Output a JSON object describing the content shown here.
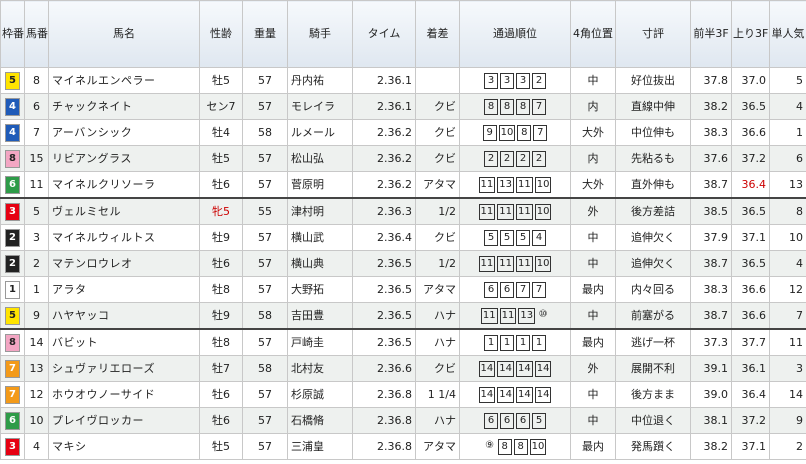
{
  "headers": {
    "waku": "枠番",
    "umaban": "馬番",
    "name": "馬名",
    "sexage": "性齢",
    "weight": "重量",
    "jockey": "騎手",
    "time": "タイム",
    "margin": "着差",
    "passing": "通過順位",
    "corner4": "4角位置",
    "comment": "寸評",
    "first3f": "前半3F",
    "last3f": "上り3F",
    "pop": "単人気"
  },
  "colors": {
    "waku1": "#ffffff",
    "waku2": "#222222",
    "waku3": "#e60012",
    "waku4": "#1f5bb8",
    "waku5": "#ffe400",
    "waku6": "#2e9b48",
    "waku7": "#f39a19",
    "waku8": "#f3a6c3",
    "highlight": "#cc0000"
  },
  "rows": [
    {
      "waku": "5",
      "umaban": "8",
      "name": "マイネルエンペラー",
      "sexage": "牡5",
      "weight": "57",
      "jockey": "丹内祐",
      "time": "2.36.1",
      "margin": "",
      "passing": [
        "3",
        "3",
        "3",
        "2"
      ],
      "corner4": "中",
      "comment": "好位抜出",
      "first3f": "37.8",
      "last3f": "37.0",
      "pop": "5"
    },
    {
      "waku": "4",
      "umaban": "6",
      "name": "チャックネイト",
      "sexage": "セン7",
      "weight": "57",
      "jockey": "モレイラ",
      "time": "2.36.1",
      "margin": "クビ",
      "passing": [
        "8",
        "8",
        "8",
        "7"
      ],
      "corner4": "内",
      "comment": "直線中伸",
      "first3f": "38.2",
      "last3f": "36.5",
      "pop": "4"
    },
    {
      "waku": "4",
      "umaban": "7",
      "name": "アーバンシック",
      "sexage": "牡4",
      "weight": "58",
      "jockey": "ルメール",
      "time": "2.36.2",
      "margin": "クビ",
      "passing": [
        "9",
        "10",
        "8",
        "7"
      ],
      "corner4": "大外",
      "comment": "中位伸も",
      "first3f": "38.3",
      "last3f": "36.6",
      "pop": "1"
    },
    {
      "waku": "8",
      "umaban": "15",
      "name": "リビアングラス",
      "sexage": "牡5",
      "weight": "57",
      "jockey": "松山弘",
      "time": "2.36.2",
      "margin": "クビ",
      "passing": [
        "2",
        "2",
        "2",
        "2"
      ],
      "corner4": "内",
      "comment": "先粘るも",
      "first3f": "37.6",
      "last3f": "37.2",
      "pop": "6"
    },
    {
      "waku": "6",
      "umaban": "11",
      "name": "マイネルクリソーラ",
      "sexage": "牡6",
      "weight": "57",
      "jockey": "菅原明",
      "time": "2.36.2",
      "margin": "アタマ",
      "passing": [
        "11",
        "13",
        "11",
        "10"
      ],
      "corner4": "大外",
      "comment": "直外伸も",
      "first3f": "38.7",
      "last3f": "36.4",
      "pop": "13"
    },
    {
      "waku": "3",
      "umaban": "5",
      "name": "ヴェルミセル",
      "sexage": "牝5",
      "weight": "55",
      "jockey": "津村明",
      "time": "2.36.3",
      "margin": "1/2",
      "passing": [
        "11",
        "11",
        "11",
        "10"
      ],
      "corner4": "外",
      "comment": "後方差詰",
      "first3f": "38.5",
      "last3f": "36.5",
      "pop": "8"
    },
    {
      "waku": "2",
      "umaban": "3",
      "name": "マイネルウィルトス",
      "sexage": "牡9",
      "weight": "57",
      "jockey": "横山武",
      "time": "2.36.4",
      "margin": "クビ",
      "passing": [
        "5",
        "5",
        "5",
        "4"
      ],
      "corner4": "中",
      "comment": "追伸欠く",
      "first3f": "37.9",
      "last3f": "37.1",
      "pop": "10"
    },
    {
      "waku": "2",
      "umaban": "2",
      "name": "マテンロウレオ",
      "sexage": "牡6",
      "weight": "57",
      "jockey": "横山典",
      "time": "2.36.5",
      "margin": "1/2",
      "passing": [
        "11",
        "11",
        "11",
        "10"
      ],
      "corner4": "中",
      "comment": "追伸欠く",
      "first3f": "38.7",
      "last3f": "36.5",
      "pop": "4"
    },
    {
      "waku": "1",
      "umaban": "1",
      "name": "アラタ",
      "sexage": "牡8",
      "weight": "57",
      "jockey": "大野拓",
      "time": "2.36.5",
      "margin": "アタマ",
      "passing": [
        "6",
        "6",
        "7",
        "7"
      ],
      "corner4": "最内",
      "comment": "内々回る",
      "first3f": "38.3",
      "last3f": "36.6",
      "pop": "12"
    },
    {
      "waku": "5",
      "umaban": "9",
      "name": "ハヤヤッコ",
      "sexage": "牡9",
      "weight": "58",
      "jockey": "吉田豊",
      "time": "2.36.5",
      "margin": "ハナ",
      "passing": [
        "11",
        "11",
        "13",
        "⑩"
      ],
      "corner4": "中",
      "comment": "前塞がる",
      "first3f": "38.7",
      "last3f": "36.6",
      "pop": "7"
    },
    {
      "waku": "8",
      "umaban": "14",
      "name": "バビット",
      "sexage": "牡8",
      "weight": "57",
      "jockey": "戸崎圭",
      "time": "2.36.5",
      "margin": "ハナ",
      "passing": [
        "1",
        "1",
        "1",
        "1"
      ],
      "corner4": "最内",
      "comment": "逃げ一杯",
      "first3f": "37.3",
      "last3f": "37.7",
      "pop": "11"
    },
    {
      "waku": "7",
      "umaban": "13",
      "name": "シュヴァリエローズ",
      "sexage": "牡7",
      "weight": "58",
      "jockey": "北村友",
      "time": "2.36.6",
      "margin": "クビ",
      "passing": [
        "14",
        "14",
        "14",
        "14"
      ],
      "corner4": "外",
      "comment": "展開不利",
      "first3f": "39.1",
      "last3f": "36.1",
      "pop": "3"
    },
    {
      "waku": "7",
      "umaban": "12",
      "name": "ホウオウノーサイド",
      "sexage": "牡6",
      "weight": "57",
      "jockey": "杉原誠",
      "time": "2.36.8",
      "margin": "1 1/4",
      "passing": [
        "14",
        "14",
        "14",
        "14"
      ],
      "corner4": "中",
      "comment": "後方まま",
      "first3f": "39.0",
      "last3f": "36.4",
      "pop": "14"
    },
    {
      "waku": "6",
      "umaban": "10",
      "name": "プレイヴロッカー",
      "sexage": "牡6",
      "weight": "57",
      "jockey": "石橋脩",
      "time": "2.36.8",
      "margin": "ハナ",
      "passing": [
        "6",
        "6",
        "6",
        "5"
      ],
      "corner4": "中",
      "comment": "中位退く",
      "first3f": "38.1",
      "last3f": "37.2",
      "pop": "9"
    },
    {
      "waku": "3",
      "umaban": "4",
      "name": "マキシ",
      "sexage": "牡5",
      "weight": "57",
      "jockey": "三浦皇",
      "time": "2.36.8",
      "margin": "アタマ",
      "passing": [
        "⑨",
        "8",
        "8",
        "10"
      ],
      "corner4": "最内",
      "comment": "発馬躓く",
      "first3f": "38.2",
      "last3f": "37.1",
      "pop": "2"
    }
  ]
}
